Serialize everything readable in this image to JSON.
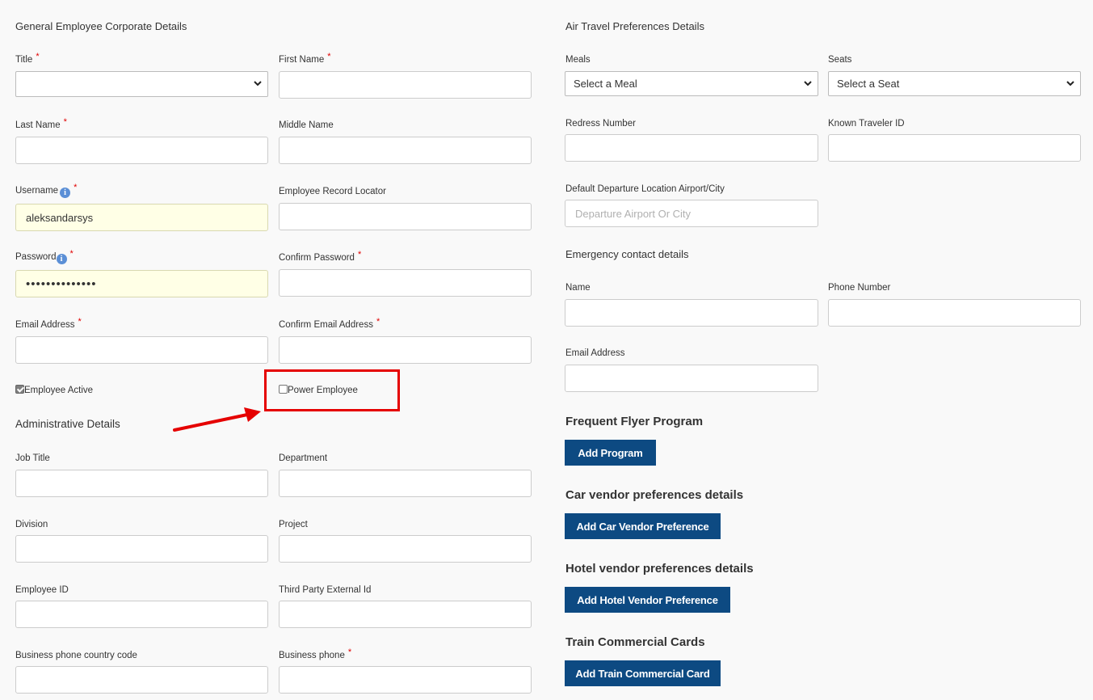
{
  "left": {
    "section_general": "General Employee Corporate Details",
    "title_label": "Title",
    "first_name_label": "First Name",
    "last_name_label": "Last Name",
    "middle_name_label": "Middle Name",
    "username_label": "Username",
    "username_value": "aleksandarsys",
    "record_locator_label": "Employee Record Locator",
    "password_label": "Password",
    "password_value": "••••••••••••••",
    "confirm_password_label": "Confirm Password",
    "email_label": "Email Address",
    "confirm_email_label": "Confirm Email Address",
    "employee_active_label": "Employee Active",
    "power_employee_label": "Power Employee",
    "section_admin": "Administrative Details",
    "job_title_label": "Job Title",
    "department_label": "Department",
    "division_label": "Division",
    "project_label": "Project",
    "employee_id_label": "Employee ID",
    "third_party_label": "Third Party External Id",
    "country_code_label": "Business phone country code",
    "business_phone_label": "Business phone",
    "required_mark": "*",
    "info_glyph": "i"
  },
  "right": {
    "section_air": "Air Travel Preferences Details",
    "meals_label": "Meals",
    "meals_value": "Select a Meal",
    "seats_label": "Seats",
    "seats_value": "Select a Seat",
    "redress_label": "Redress Number",
    "known_traveler_label": "Known Traveler ID",
    "departure_label": "Default Departure Location Airport/City",
    "departure_placeholder": "Departure Airport Or City",
    "section_emergency": "Emergency contact details",
    "ec_name_label": "Name",
    "ec_phone_label": "Phone Number",
    "ec_email_label": "Email Address",
    "ff_heading": "Frequent Flyer Program",
    "ff_button": "Add Program",
    "car_heading": "Car vendor preferences details",
    "car_button": "Add Car Vendor Preference",
    "hotel_heading": "Hotel vendor preferences details",
    "hotel_button": "Add Hotel Vendor Preference",
    "train_heading": "Train Commercial Cards",
    "train_button": "Add Train Commercial Card"
  },
  "state": {
    "employee_active_checked": true,
    "power_employee_checked": false
  },
  "colors": {
    "button_bg": "#0d4a82",
    "required": "#e00000",
    "annotation": "#e50000",
    "autofill_bg": "#ffffe6"
  }
}
